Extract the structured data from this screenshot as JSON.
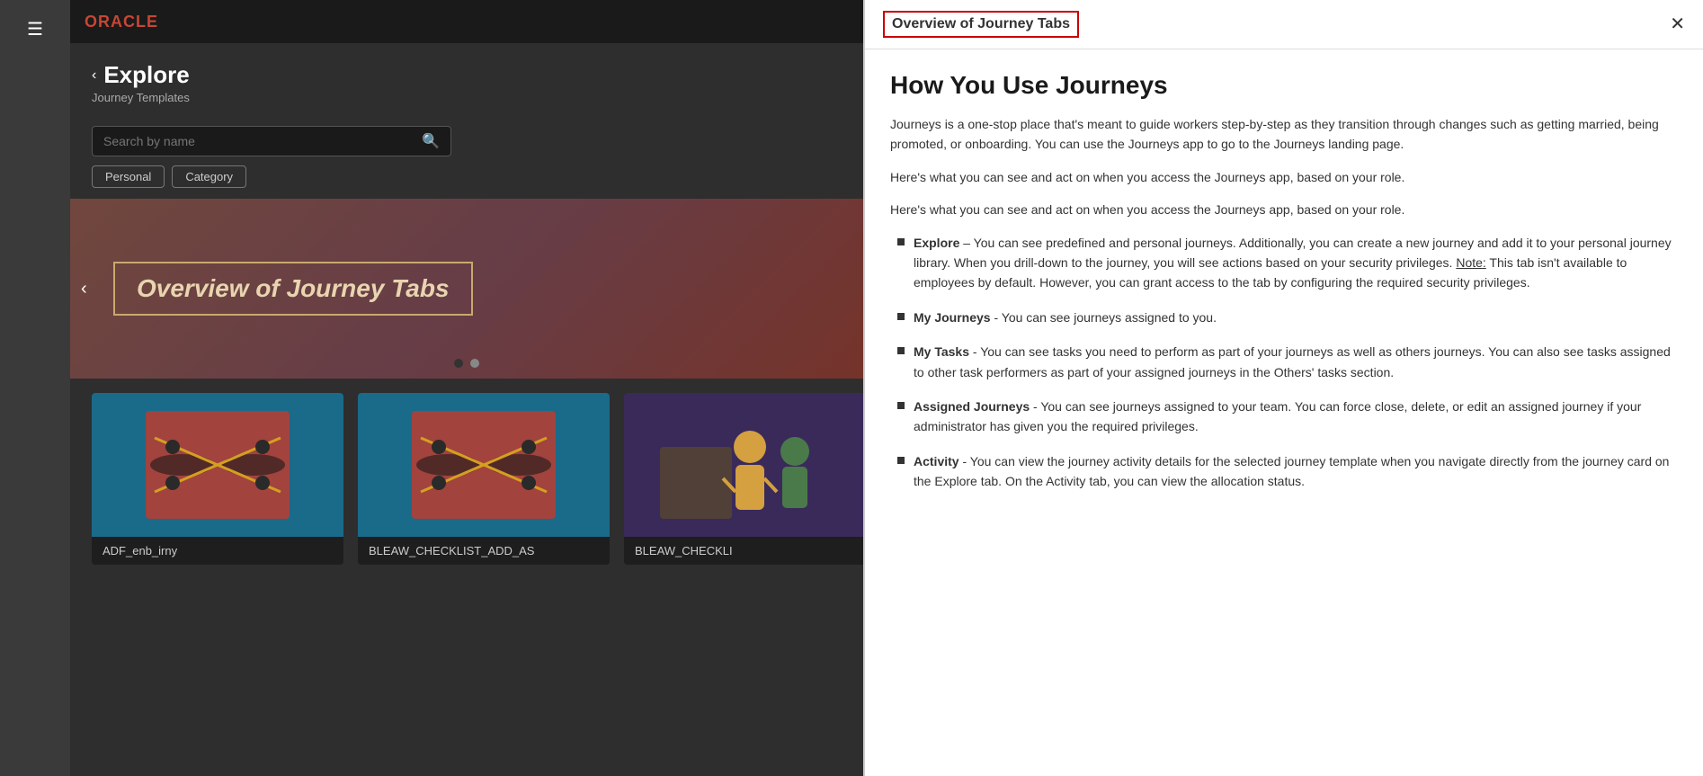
{
  "topbar": {
    "logo": "ORACLE"
  },
  "sidebar": {
    "hamburger": "☰"
  },
  "explore": {
    "back_arrow": "‹",
    "title": "Explore",
    "subtitle": "Journey Templates"
  },
  "search": {
    "placeholder": "Search by name",
    "icon": "🔍",
    "filter_personal": "Personal",
    "filter_category": "Category"
  },
  "banner": {
    "prev_arrow": "‹",
    "title": "Overview of Journey Tabs",
    "dot1_active": true,
    "dot2_active": false
  },
  "cards": [
    {
      "label": "ADF_enb_irny",
      "color1": "#1a6a8a",
      "color2": "#c43a2a"
    },
    {
      "label": "BLEAW_CHECKLIST_ADD_AS",
      "color1": "#1a6a8a",
      "color2": "#c43a2a"
    },
    {
      "label": "BLEAW_CHECKLI",
      "color1": "#4a3a6a",
      "color2": "#6a4a8a"
    }
  ],
  "right_panel": {
    "title": "Overview of Journey Tabs",
    "close_icon": "✕",
    "main_title": "How You Use Journeys",
    "para1": "Journeys is a one-stop place that's meant to guide workers step-by-step as they transition through changes such as getting married, being promoted, or onboarding. You can use the Journeys app to go to the Journeys landing page.",
    "para2": "Here's what you can see and act on when you access the Journeys app, based on your role.",
    "para3": "Here's what you can see and act on when you access the Journeys app, based on your role.",
    "list_items": [
      {
        "id": "explore",
        "bold": "Explore",
        "dash": " –",
        "text": " You can see predefined and personal journeys. Additionally, you can create a new journey and add it to your personal journey library. When you drill-down to the journey, you will see actions based on your security privileges. ",
        "note_label": "Note:",
        "note_text": " This tab isn't available to employees by default. However, you can grant access to the tab by configuring the required security privileges."
      },
      {
        "id": "my-journeys",
        "bold": "My Journeys",
        "dash": "",
        "text": " - You can see journeys assigned to you."
      },
      {
        "id": "my-tasks",
        "bold": "My Tasks",
        "dash": "",
        "text": " - You can see tasks you need to perform as part of your journeys as well as others journeys. You can also see tasks assigned to other task performers as part of your assigned journeys in the Others' tasks section."
      },
      {
        "id": "assigned-journeys",
        "bold": "Assigned Journeys",
        "dash": "",
        "text": " - You can see journeys assigned to your team. You can force close, delete, or edit an assigned journey if your administrator has given you the required privileges."
      },
      {
        "id": "activity",
        "bold": "Activity",
        "dash": "",
        "text": " - You can view the journey activity details for the selected journey template when you navigate directly from the journey card on the Explore tab. On the Activity tab, you can view the allocation status."
      }
    ]
  }
}
